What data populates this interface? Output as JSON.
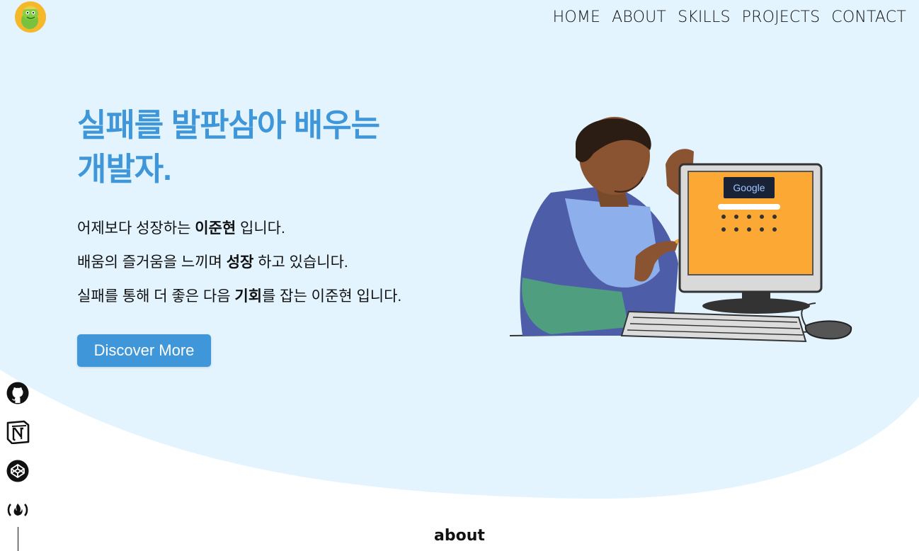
{
  "nav": {
    "home": "HOME",
    "about": "ABOUT",
    "skills": "SKILLS",
    "projects": "PROJECTS",
    "contact": "CONTACT"
  },
  "hero": {
    "headline_line1": "실패를 발판삼아 배우는",
    "headline_line2": "개발자.",
    "line1": {
      "before": "어제보다 성장하는 ",
      "bold": "이준현",
      "after": " 입니다."
    },
    "line2": {
      "before": "배움의 즐거움을 느끼며 ",
      "bold": "성장",
      "after": " 하고 있습니다."
    },
    "line3": {
      "before": "실패를 통해 더 좋은 다음 ",
      "bold": "기회",
      "after": "를 잡는 이준현 입니다."
    },
    "cta_label": "Discover More"
  },
  "screen": {
    "logo_text": "Google"
  },
  "social": {
    "icons": [
      "github-icon",
      "notion-icon",
      "codepen-icon",
      "freecodecamp-icon"
    ]
  },
  "section": {
    "about_title": "about"
  },
  "colors": {
    "accent": "#3f97d9",
    "hero_bg": "#e3f4fe",
    "monitor_screen": "#fba934"
  }
}
